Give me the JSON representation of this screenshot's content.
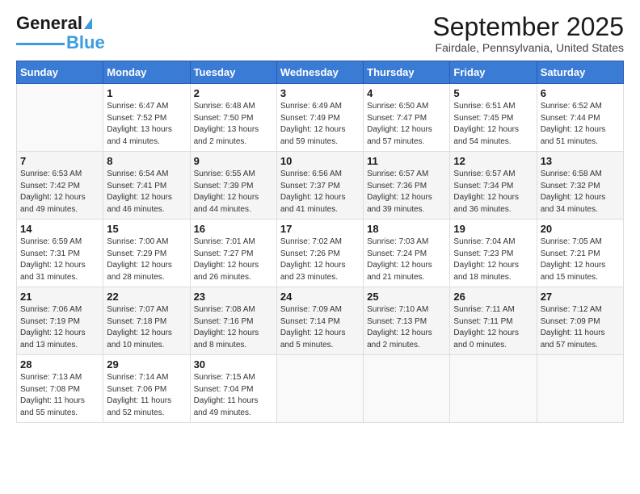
{
  "header": {
    "logo_line1": "General",
    "logo_line2": "Blue",
    "month_title": "September 2025",
    "location": "Fairdale, Pennsylvania, United States"
  },
  "days_of_week": [
    "Sunday",
    "Monday",
    "Tuesday",
    "Wednesday",
    "Thursday",
    "Friday",
    "Saturday"
  ],
  "weeks": [
    [
      {
        "day": "",
        "sunrise": "",
        "sunset": "",
        "daylight": ""
      },
      {
        "day": "1",
        "sunrise": "Sunrise: 6:47 AM",
        "sunset": "Sunset: 7:52 PM",
        "daylight": "Daylight: 13 hours and 4 minutes."
      },
      {
        "day": "2",
        "sunrise": "Sunrise: 6:48 AM",
        "sunset": "Sunset: 7:50 PM",
        "daylight": "Daylight: 13 hours and 2 minutes."
      },
      {
        "day": "3",
        "sunrise": "Sunrise: 6:49 AM",
        "sunset": "Sunset: 7:49 PM",
        "daylight": "Daylight: 12 hours and 59 minutes."
      },
      {
        "day": "4",
        "sunrise": "Sunrise: 6:50 AM",
        "sunset": "Sunset: 7:47 PM",
        "daylight": "Daylight: 12 hours and 57 minutes."
      },
      {
        "day": "5",
        "sunrise": "Sunrise: 6:51 AM",
        "sunset": "Sunset: 7:45 PM",
        "daylight": "Daylight: 12 hours and 54 minutes."
      },
      {
        "day": "6",
        "sunrise": "Sunrise: 6:52 AM",
        "sunset": "Sunset: 7:44 PM",
        "daylight": "Daylight: 12 hours and 51 minutes."
      }
    ],
    [
      {
        "day": "7",
        "sunrise": "Sunrise: 6:53 AM",
        "sunset": "Sunset: 7:42 PM",
        "daylight": "Daylight: 12 hours and 49 minutes."
      },
      {
        "day": "8",
        "sunrise": "Sunrise: 6:54 AM",
        "sunset": "Sunset: 7:41 PM",
        "daylight": "Daylight: 12 hours and 46 minutes."
      },
      {
        "day": "9",
        "sunrise": "Sunrise: 6:55 AM",
        "sunset": "Sunset: 7:39 PM",
        "daylight": "Daylight: 12 hours and 44 minutes."
      },
      {
        "day": "10",
        "sunrise": "Sunrise: 6:56 AM",
        "sunset": "Sunset: 7:37 PM",
        "daylight": "Daylight: 12 hours and 41 minutes."
      },
      {
        "day": "11",
        "sunrise": "Sunrise: 6:57 AM",
        "sunset": "Sunset: 7:36 PM",
        "daylight": "Daylight: 12 hours and 39 minutes."
      },
      {
        "day": "12",
        "sunrise": "Sunrise: 6:57 AM",
        "sunset": "Sunset: 7:34 PM",
        "daylight": "Daylight: 12 hours and 36 minutes."
      },
      {
        "day": "13",
        "sunrise": "Sunrise: 6:58 AM",
        "sunset": "Sunset: 7:32 PM",
        "daylight": "Daylight: 12 hours and 34 minutes."
      }
    ],
    [
      {
        "day": "14",
        "sunrise": "Sunrise: 6:59 AM",
        "sunset": "Sunset: 7:31 PM",
        "daylight": "Daylight: 12 hours and 31 minutes."
      },
      {
        "day": "15",
        "sunrise": "Sunrise: 7:00 AM",
        "sunset": "Sunset: 7:29 PM",
        "daylight": "Daylight: 12 hours and 28 minutes."
      },
      {
        "day": "16",
        "sunrise": "Sunrise: 7:01 AM",
        "sunset": "Sunset: 7:27 PM",
        "daylight": "Daylight: 12 hours and 26 minutes."
      },
      {
        "day": "17",
        "sunrise": "Sunrise: 7:02 AM",
        "sunset": "Sunset: 7:26 PM",
        "daylight": "Daylight: 12 hours and 23 minutes."
      },
      {
        "day": "18",
        "sunrise": "Sunrise: 7:03 AM",
        "sunset": "Sunset: 7:24 PM",
        "daylight": "Daylight: 12 hours and 21 minutes."
      },
      {
        "day": "19",
        "sunrise": "Sunrise: 7:04 AM",
        "sunset": "Sunset: 7:23 PM",
        "daylight": "Daylight: 12 hours and 18 minutes."
      },
      {
        "day": "20",
        "sunrise": "Sunrise: 7:05 AM",
        "sunset": "Sunset: 7:21 PM",
        "daylight": "Daylight: 12 hours and 15 minutes."
      }
    ],
    [
      {
        "day": "21",
        "sunrise": "Sunrise: 7:06 AM",
        "sunset": "Sunset: 7:19 PM",
        "daylight": "Daylight: 12 hours and 13 minutes."
      },
      {
        "day": "22",
        "sunrise": "Sunrise: 7:07 AM",
        "sunset": "Sunset: 7:18 PM",
        "daylight": "Daylight: 12 hours and 10 minutes."
      },
      {
        "day": "23",
        "sunrise": "Sunrise: 7:08 AM",
        "sunset": "Sunset: 7:16 PM",
        "daylight": "Daylight: 12 hours and 8 minutes."
      },
      {
        "day": "24",
        "sunrise": "Sunrise: 7:09 AM",
        "sunset": "Sunset: 7:14 PM",
        "daylight": "Daylight: 12 hours and 5 minutes."
      },
      {
        "day": "25",
        "sunrise": "Sunrise: 7:10 AM",
        "sunset": "Sunset: 7:13 PM",
        "daylight": "Daylight: 12 hours and 2 minutes."
      },
      {
        "day": "26",
        "sunrise": "Sunrise: 7:11 AM",
        "sunset": "Sunset: 7:11 PM",
        "daylight": "Daylight: 12 hours and 0 minutes."
      },
      {
        "day": "27",
        "sunrise": "Sunrise: 7:12 AM",
        "sunset": "Sunset: 7:09 PM",
        "daylight": "Daylight: 11 hours and 57 minutes."
      }
    ],
    [
      {
        "day": "28",
        "sunrise": "Sunrise: 7:13 AM",
        "sunset": "Sunset: 7:08 PM",
        "daylight": "Daylight: 11 hours and 55 minutes."
      },
      {
        "day": "29",
        "sunrise": "Sunrise: 7:14 AM",
        "sunset": "Sunset: 7:06 PM",
        "daylight": "Daylight: 11 hours and 52 minutes."
      },
      {
        "day": "30",
        "sunrise": "Sunrise: 7:15 AM",
        "sunset": "Sunset: 7:04 PM",
        "daylight": "Daylight: 11 hours and 49 minutes."
      },
      {
        "day": "",
        "sunrise": "",
        "sunset": "",
        "daylight": ""
      },
      {
        "day": "",
        "sunrise": "",
        "sunset": "",
        "daylight": ""
      },
      {
        "day": "",
        "sunrise": "",
        "sunset": "",
        "daylight": ""
      },
      {
        "day": "",
        "sunrise": "",
        "sunset": "",
        "daylight": ""
      }
    ]
  ]
}
